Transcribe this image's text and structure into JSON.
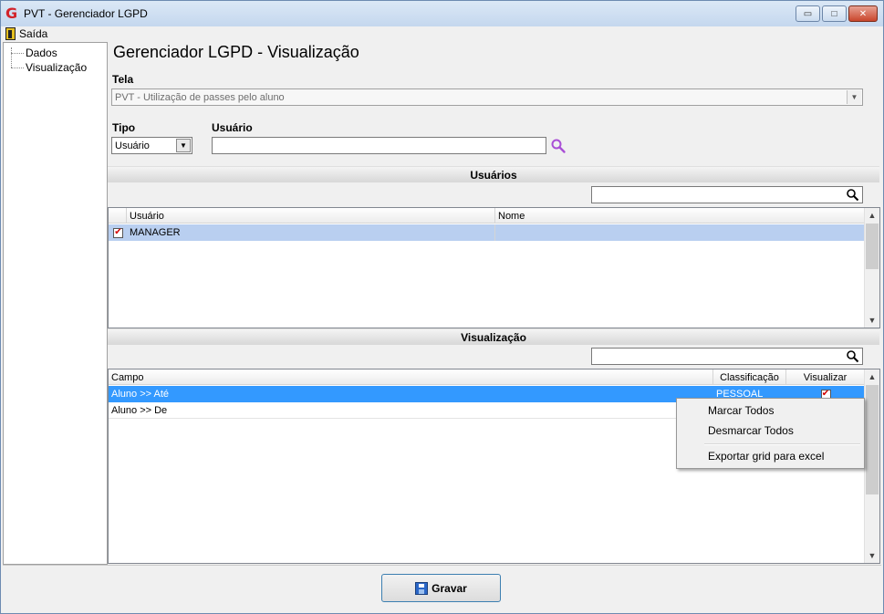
{
  "window": {
    "title": "PVT - Gerenciador LGPD",
    "logo_letter": "G",
    "minimize_glyph": "▭",
    "maximize_glyph": "□",
    "close_glyph": "✕"
  },
  "menu": {
    "exit_label": "Saída"
  },
  "tree": {
    "items": [
      "Dados",
      "Visualização"
    ]
  },
  "page_title": "Gerenciador LGPD - Visualização",
  "tela": {
    "label": "Tela",
    "value": "PVT - Utilização de passes pelo aluno"
  },
  "tipo": {
    "label": "Tipo",
    "value": "Usuário"
  },
  "usuario": {
    "label": "Usuário",
    "value": ""
  },
  "usuarios_section": {
    "title": "Usuários",
    "search_value": "",
    "columns": [
      "Usuário",
      "Nome"
    ],
    "rows": [
      {
        "checked": true,
        "usuario": "MANAGER",
        "nome": ""
      }
    ]
  },
  "visualizacao_section": {
    "title": "Visualização",
    "search_value": "",
    "columns": [
      "Campo",
      "Classificação",
      "Visualizar"
    ],
    "rows": [
      {
        "campo": "Aluno >> Até",
        "classificacao": "PESSOAL",
        "visualizar": true
      },
      {
        "campo": "Aluno >> De",
        "classificacao": "",
        "visualizar": false
      }
    ]
  },
  "context_menu": {
    "items": [
      "Marcar Todos",
      "Desmarcar Todos",
      "Exportar grid para excel"
    ]
  },
  "save_button": {
    "label": "Gravar"
  },
  "colors": {
    "selected_row": "#3399ff",
    "selected_row_light": "#b9cff0",
    "section_header": "#d7d7d7"
  }
}
